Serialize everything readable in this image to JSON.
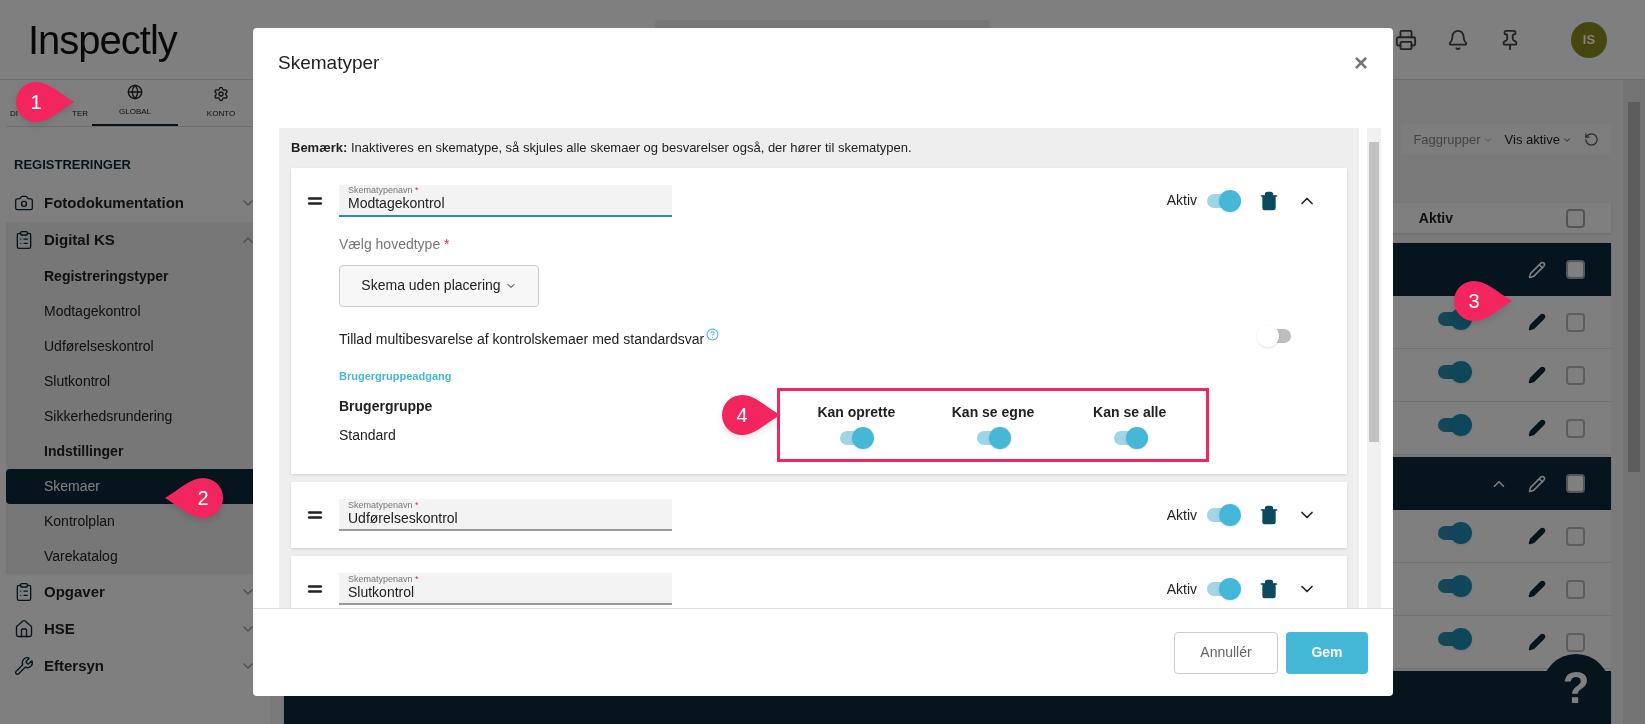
{
  "header": {
    "logo": "Inspectly",
    "avatar": "IS"
  },
  "sidebar": {
    "tabs": [
      {
        "label_parts": [
          "DI",
          "TER"
        ],
        "selected": false
      },
      {
        "label_parts": [
          "GLOBAL"
        ],
        "selected": true
      },
      {
        "label_parts": [
          "KONTO"
        ],
        "selected": false
      }
    ],
    "section": "REGISTRERINGER",
    "items": [
      {
        "label": "Fotodokumentation",
        "expanded": false
      },
      {
        "label": "Digital KS",
        "expanded": true,
        "children": [
          {
            "label": "Registreringstyper",
            "kind": "heading",
            "selected": false
          },
          {
            "label": "Modtagekontrol",
            "kind": "link",
            "selected": false
          },
          {
            "label": "Udførelseskontrol",
            "kind": "link",
            "selected": false
          },
          {
            "label": "Slutkontrol",
            "kind": "link",
            "selected": false
          },
          {
            "label": "Sikkerhedsrundering",
            "kind": "link",
            "selected": false
          },
          {
            "label": "Indstillinger",
            "kind": "heading",
            "selected": false
          },
          {
            "label": "Skemaer",
            "kind": "link",
            "selected": true
          },
          {
            "label": "Kontrolplan",
            "kind": "link",
            "selected": false
          },
          {
            "label": "Varekatalog",
            "kind": "link",
            "selected": false
          }
        ]
      },
      {
        "label": "Opgaver",
        "expanded": false
      },
      {
        "label": "HSE",
        "expanded": false
      },
      {
        "label": "Eftersyn",
        "expanded": false
      }
    ]
  },
  "filters": [
    {
      "label": "Faggrupper",
      "strong": false
    },
    {
      "label": "Vis aktive",
      "strong": true
    }
  ],
  "table": {
    "column": "Aktiv",
    "all_checked": false,
    "rows": [
      {
        "kind": "group",
        "expanded": false,
        "checked": false
      },
      {
        "kind": "item",
        "active": true,
        "checked": false
      },
      {
        "kind": "item",
        "active": true,
        "checked": false
      },
      {
        "kind": "item",
        "active": true,
        "checked": false
      },
      {
        "kind": "group",
        "expanded": true,
        "checked": false
      },
      {
        "kind": "item",
        "active": true,
        "checked": false
      },
      {
        "kind": "item",
        "active": true,
        "checked": false
      },
      {
        "kind": "item",
        "active": true,
        "checked": false
      },
      {
        "kind": "group",
        "expanded": false
      }
    ]
  },
  "help": "?",
  "modal": {
    "title": "Skematyper",
    "close": "×",
    "note": "**Bemærk:** Inaktiveres en skematype, så skjules alle skemaer og besvarelser også, der hører til skematypen.",
    "types": [
      {
        "field_label": "Skematypenavn",
        "required_mark": "*",
        "value": "Modtagekontrol",
        "focused": true,
        "active_label": "Aktiv",
        "active": true,
        "expanded": true,
        "main_type_label": "Vælg hovedtype",
        "main_type_required": "*",
        "main_type": "Skema uden placering",
        "multi_label": "Tillad multibesvarelse af kontrolskemaer med standardsvar",
        "multi_on": false,
        "access_heading": "Brugergruppeadgang",
        "group_column": "Brugergruppe",
        "permission_columns": [
          "Kan oprette",
          "Kan se egne",
          "Kan se alle"
        ],
        "groups": [
          {
            "name": "Standard",
            "permissions": [
              true,
              true,
              true
            ]
          }
        ]
      },
      {
        "field_label": "Skematypenavn",
        "required_mark": "*",
        "value": "Udførelseskontrol",
        "focused": false,
        "active_label": "Aktiv",
        "active": true,
        "expanded": false
      },
      {
        "field_label": "Skematypenavn",
        "required_mark": "*",
        "value": "Slutkontrol",
        "focused": false,
        "active_label": "Aktiv",
        "active": true,
        "expanded": false
      }
    ],
    "cancel": "Annullér",
    "save": "Gem"
  },
  "callouts": [
    "1",
    "2",
    "3",
    "4"
  ]
}
